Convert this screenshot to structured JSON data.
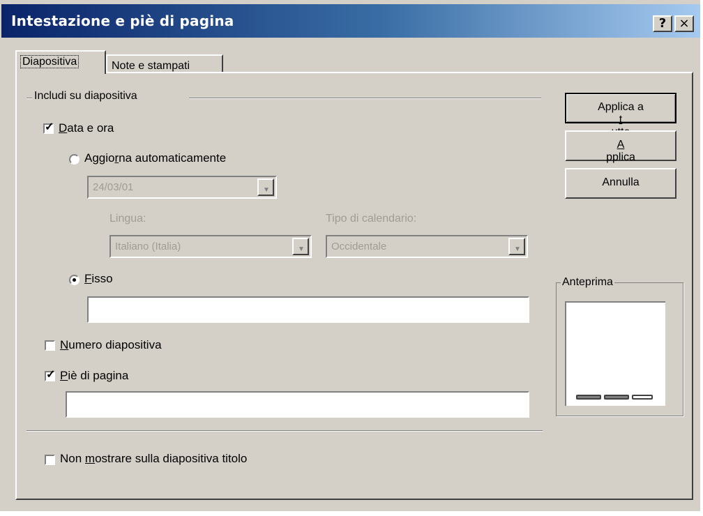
{
  "window": {
    "title": "Intestazione e piè di pagina",
    "help_button": "?",
    "close_button": "×"
  },
  "tabs": [
    {
      "label": "Diapositiva",
      "active": true
    },
    {
      "label": "Note e stampati",
      "active": false
    }
  ],
  "group": {
    "label": "Includi su diapositiva"
  },
  "date_time": {
    "label": "Data e ora",
    "accel": "D",
    "rest": "ata e ora",
    "checked": true
  },
  "auto_update": {
    "pre": "Aggio",
    "accel": "r",
    "post": "na automaticamente",
    "selected": false
  },
  "date_combo": {
    "value": "24/03/01",
    "enabled": false
  },
  "language": {
    "label": "Lingua:",
    "value": "Italiano (Italia)"
  },
  "calendar": {
    "label": "Tipo di calendario:",
    "value": "Occidentale"
  },
  "fixed": {
    "label": "Fisso",
    "accel": "F",
    "rest": "isso",
    "selected": true,
    "value": ""
  },
  "slide_number": {
    "label": "Numero diapositiva",
    "accel": "N",
    "rest": "umero diapositiva",
    "checked": false
  },
  "footer": {
    "label": "Piè di pagina",
    "accel": "P",
    "rest": "iè di pagina",
    "checked": true,
    "value": ""
  },
  "hide_title": {
    "pre": "Non ",
    "accel": "m",
    "post": "ostrare sulla diapositiva titolo",
    "checked": false
  },
  "buttons": {
    "apply_all": {
      "pre": "Applica a ",
      "accel": "t",
      "post": "utte"
    },
    "apply": {
      "pre": "",
      "accel": "A",
      "post": "pplica"
    },
    "cancel": {
      "label": "Annulla"
    }
  },
  "preview": {
    "label": "Anteprima"
  },
  "icons": {
    "check": "✓",
    "dropdown": "▼"
  }
}
